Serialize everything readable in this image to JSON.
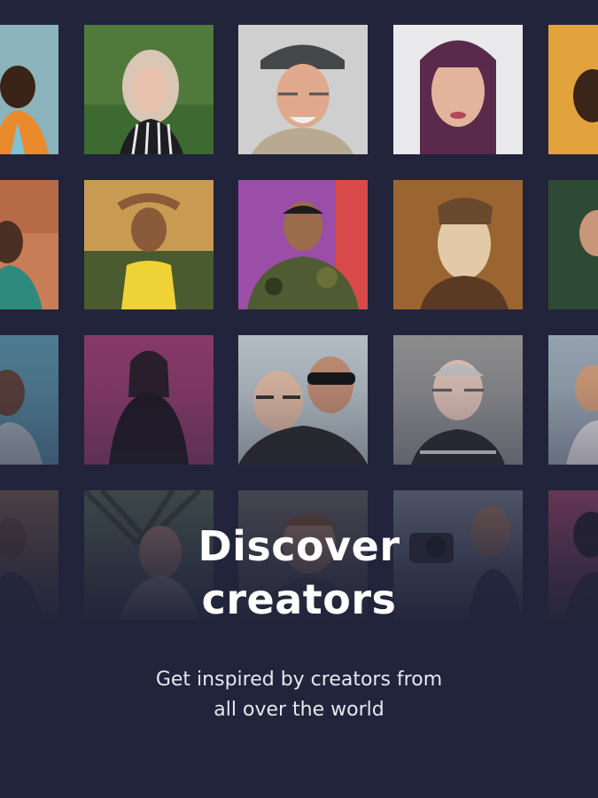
{
  "onboarding": {
    "title_line1": "Discover",
    "title_line2": "creators",
    "subtitle_line1": "Get inspired by creators from",
    "subtitle_line2": "all over the world"
  },
  "grid": {
    "rows": 4,
    "columns": 5,
    "tile_kind": "creator-portrait-photo"
  },
  "colors": {
    "background": "#21243a",
    "title": "#ffffff",
    "subtitle": "#e6e7ee"
  }
}
